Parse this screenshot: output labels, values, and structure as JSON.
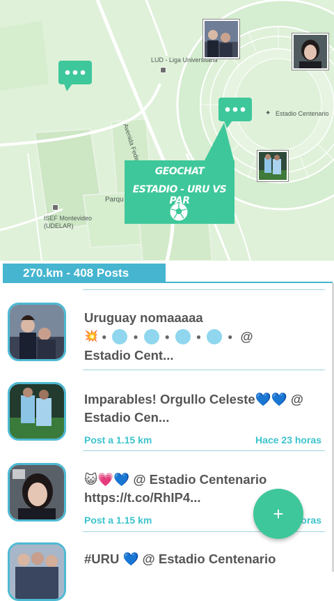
{
  "map": {
    "labels": {
      "lud": "LUD - Liga Universitaria",
      "estadio": "Estadio Centenario",
      "avenida": "Avenida Federico V",
      "parque": "Parqu",
      "isef": "ISEF Montevideo (UDELAR)"
    },
    "geochat": {
      "line1": "GEOCHAT",
      "line2": "ESTADIO - URU VS PAR"
    },
    "colors": {
      "park": "#dff1d9",
      "field": "#cfe8c6",
      "pin": "#3ec79a"
    }
  },
  "header": {
    "title": "270.km - 408 Posts"
  },
  "posts": [
    {
      "text_line1": "Uruguay nomaaaaa",
      "text_line3": "Estadio Cent...",
      "at_sign": "@",
      "emoji_prefix": "💥"
    },
    {
      "text_line1": "Imparables! Orgullo Celeste💙💙 @",
      "text_line2": "Estadio Cen...",
      "location": "Post a 1.15 km",
      "time": "Hace 23 horas"
    },
    {
      "text_line1": "😺💗💙 @ Estadio Centenario",
      "text_line2": "https://t.co/RhIP4...",
      "location": "Post a 1.15 km",
      "time": "Hace 23 horas"
    },
    {
      "text_line1": "#URU 💙 @ Estadio Centenario"
    }
  ],
  "fab": {
    "label": "+"
  },
  "accent": "#45b5d0",
  "meta_color": "#3bc3cc"
}
